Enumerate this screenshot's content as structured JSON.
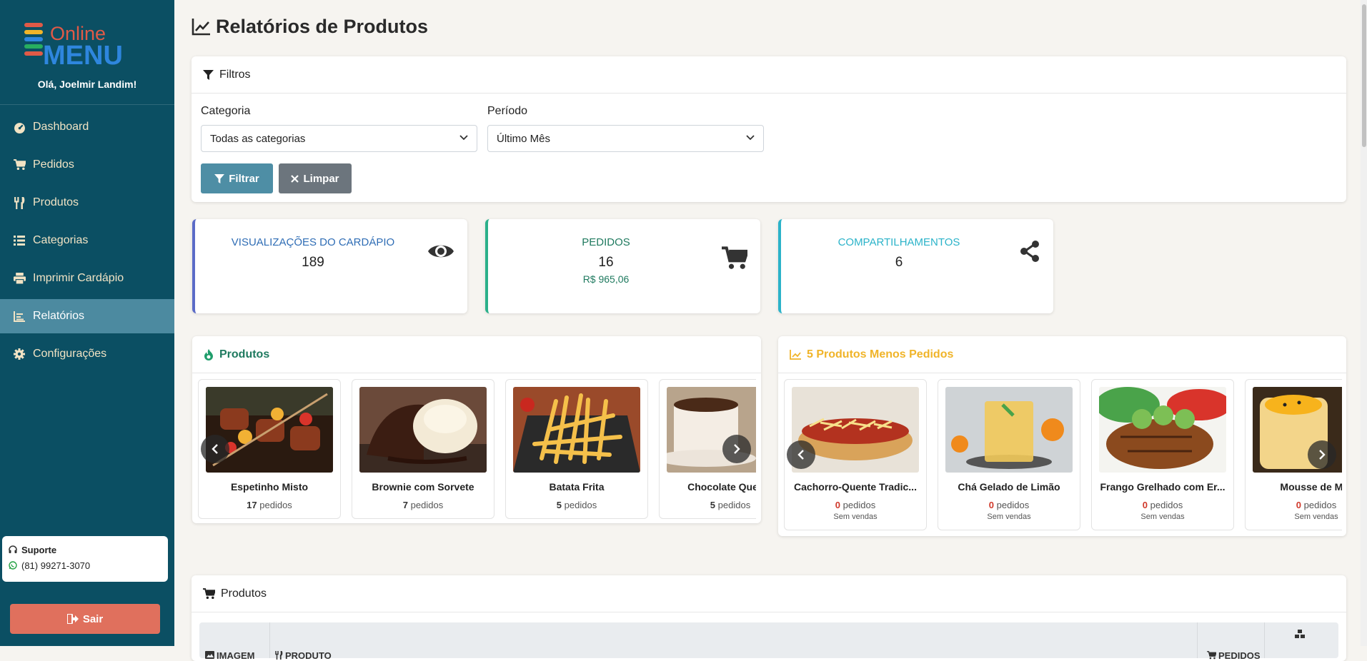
{
  "app": {
    "logo_top": "Online",
    "logo_bottom": "MENU",
    "greeting": "Olá, Joelmir Landim!"
  },
  "sidebar": {
    "items": [
      {
        "label": "Dashboard",
        "icon": "gauge-icon"
      },
      {
        "label": "Pedidos",
        "icon": "cart-icon"
      },
      {
        "label": "Produtos",
        "icon": "utensils-icon"
      },
      {
        "label": "Categorias",
        "icon": "list-icon"
      },
      {
        "label": "Imprimir Cardápio",
        "icon": "print-icon"
      },
      {
        "label": "Relatórios",
        "icon": "chart-icon",
        "active": true
      },
      {
        "label": "Configurações",
        "icon": "gear-icon"
      }
    ],
    "support_title": "Suporte",
    "support_phone": "(81) 99271-3070",
    "logout_label": "Sair"
  },
  "page": {
    "title": "Relatórios de Produtos"
  },
  "filters": {
    "header": "Filtros",
    "category_label": "Categoria",
    "category_value": "Todas as categorias",
    "period_label": "Período",
    "period_value": "Último Mês",
    "filter_button": "Filtrar",
    "clear_button": "Limpar"
  },
  "stats": [
    {
      "label": "Visualizações do Cardápio",
      "value": "189",
      "color": "#2f6db5",
      "border": "#5b6bc7"
    },
    {
      "label": "Pedidos",
      "value": "16",
      "sub": "R$ 965,06",
      "color": "#1f7a5f",
      "border": "#2bb08a"
    },
    {
      "label": "Compartilhamentos",
      "value": "6",
      "color": "#2bb3c9",
      "border": "#2bb3c9"
    }
  ],
  "top_products": {
    "header": "Produtos",
    "items": [
      {
        "name": "Espetinho Misto",
        "count": "17",
        "unit": "pedidos"
      },
      {
        "name": "Brownie com Sorvete",
        "count": "7",
        "unit": "pedidos"
      },
      {
        "name": "Batata Frita",
        "count": "5",
        "unit": "pedidos"
      },
      {
        "name": "Chocolate Quente",
        "count": "5",
        "unit": "pedidos"
      }
    ]
  },
  "least_products": {
    "header": "5 Produtos Menos Pedidos",
    "no_sales": "Sem vendas",
    "items": [
      {
        "name": "Cachorro-Quente Tradic...",
        "count": "0",
        "unit": "pedidos"
      },
      {
        "name": "Chá Gelado de Limão",
        "count": "0",
        "unit": "pedidos"
      },
      {
        "name": "Frango Grelhado com Er...",
        "count": "0",
        "unit": "pedidos"
      },
      {
        "name": "Mousse de Mar",
        "count": "0",
        "unit": "pedidos"
      }
    ]
  },
  "products_table": {
    "header": "Produtos",
    "columns": [
      "IMAGEM",
      "PRODUTO",
      "PEDIDOS"
    ]
  }
}
